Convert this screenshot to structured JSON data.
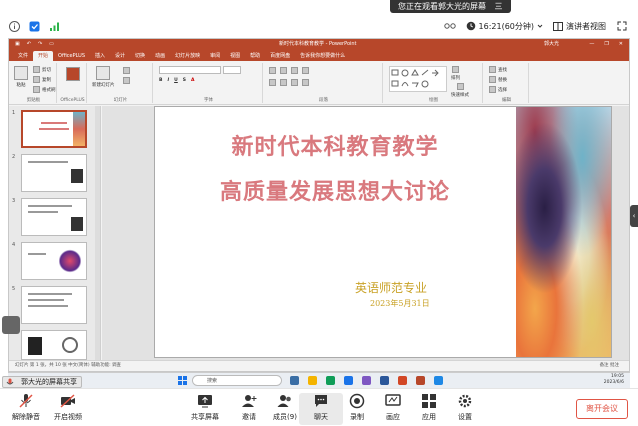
{
  "meeting": {
    "share_banner": "您正在观看郭大光的屏幕",
    "share_banner_menu": "三",
    "timer": "16:21(60分钟)",
    "view_mode": "演讲者视图",
    "sharer_label": "郭大光的屏幕共享"
  },
  "powerpoint": {
    "doc_title": "新时代本科教育教学 - PowerPoint",
    "user": "郭大光",
    "tabs": [
      "文件",
      "开始",
      "OfficePLUS",
      "插入",
      "设计",
      "切换",
      "动画",
      "幻灯片放映",
      "审阅",
      "视图",
      "帮助",
      "百度网盘",
      "告诉我你想要做什么"
    ],
    "active_tab": "开始",
    "ribbon_groups": [
      "剪贴板",
      "OfficePLUS",
      "幻灯片",
      "字体",
      "段落",
      "绘图",
      "编辑"
    ],
    "ribbon_buttons": {
      "paste": "粘贴",
      "new_slide": "新建幻灯片",
      "cut": "剪切",
      "copy": "复制",
      "format_painter": "格式刷",
      "find": "查找",
      "replace": "替换",
      "select": "选择",
      "arrange": "排列",
      "quick_styles": "快速样式"
    },
    "slide": {
      "title_line1": "新时代本科教育教学",
      "title_line2": "高质量发展思想大讨论",
      "major": "英语师范专业",
      "date": "2023年5月31日"
    },
    "thumbnails": [
      "1",
      "2",
      "3",
      "4",
      "5",
      "6"
    ],
    "status_left": "幻灯片 第 1 张，共 10 张    中文(简体)    辅助功能: 调查",
    "status_right": "备注   批注"
  },
  "taskbar": {
    "search_placeholder": "搜索",
    "time": "19:05",
    "date": "2023/6/6"
  },
  "controls": {
    "mute": "解除静音",
    "video": "开启视频",
    "share": "共享屏幕",
    "invite": "邀请",
    "members": "成员(9)",
    "chat": "聊天",
    "record": "录制",
    "apps_label": "画应",
    "apps": "应用",
    "settings": "设置",
    "leave": "离开会议"
  },
  "colors": {
    "ppt_accent": "#b7472a",
    "title_pink": "#d9797e",
    "subtitle_gold": "#c9a227",
    "leave_red": "#e05545"
  }
}
